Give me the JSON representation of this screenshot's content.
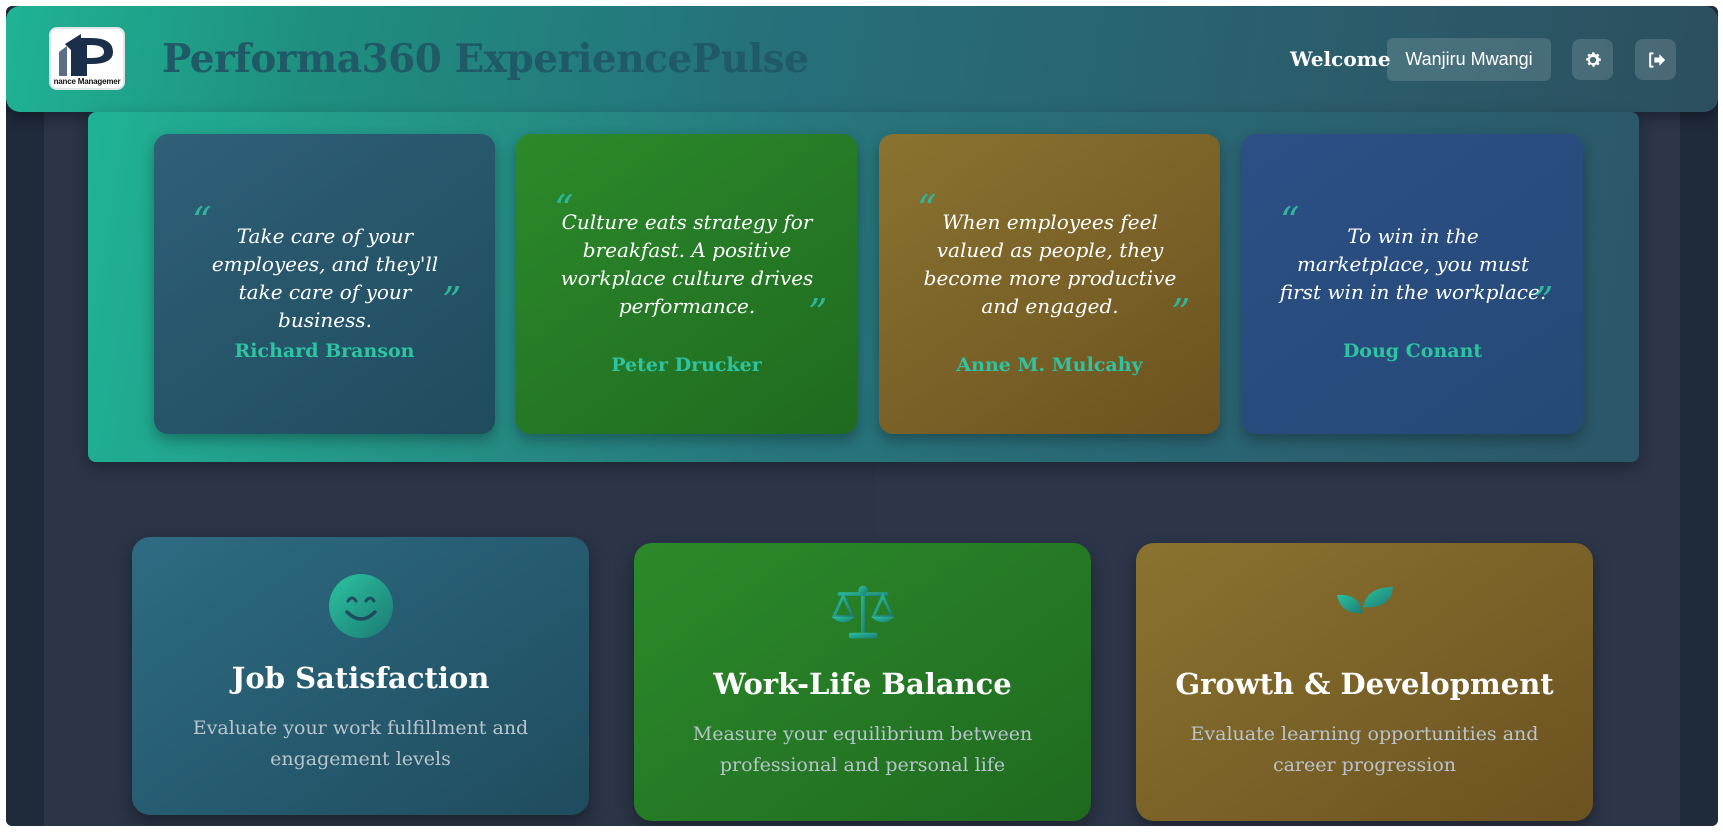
{
  "header": {
    "logo_caption": "nance Managemer",
    "title": "Performa360 ExperiencePulse",
    "welcome_label": "Welcome",
    "user_name": "Wanjiru Mwangi",
    "settings_icon": "gear-icon",
    "logout_icon": "logout-icon"
  },
  "quotes": [
    {
      "text": "Take care of your employees, and they'll take care of your business.",
      "author": "Richard Branson",
      "open_mark": "“",
      "close_mark": "”"
    },
    {
      "text": "Culture eats strategy for breakfast. A positive workplace culture drives performance.",
      "author": "Peter Drucker",
      "open_mark": "“",
      "close_mark": "”"
    },
    {
      "text": "When employees feel valued as people, they become more productive and engaged.",
      "author": "Anne M. Mulcahy",
      "open_mark": "“",
      "close_mark": "”"
    },
    {
      "text": "To win in the marketplace, you must first win in the workplace.",
      "author": "Doug Conant",
      "open_mark": "“",
      "close_mark": "”"
    }
  ],
  "metrics": [
    {
      "title": "Job Satisfaction",
      "description": "Evaluate your work fulfillment and engagement levels",
      "icon": "smile-icon"
    },
    {
      "title": "Work-Life Balance",
      "description": "Measure your equilibrium between professional and personal life",
      "icon": "balance-scale-icon"
    },
    {
      "title": "Growth & Development",
      "description": "Evaluate learning opportunities and career progression",
      "icon": "seedling-icon"
    }
  ],
  "colors": {
    "accent": "#2ec4a2",
    "background": "#1f2a3b"
  }
}
